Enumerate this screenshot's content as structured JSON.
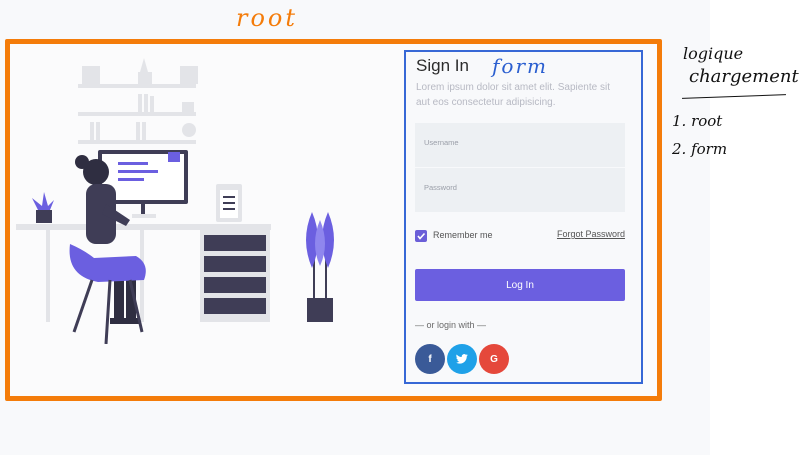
{
  "annotations": {
    "root_label": "root",
    "form_label": "form",
    "notes_title_line1": "logique",
    "notes_title_line2": "chargement",
    "notes_step1": "1. root",
    "notes_step2": "2. form"
  },
  "form": {
    "title": "Sign In",
    "subtitle": "Lorem ipsum dolor sit amet elit. Sapiente sit aut eos consectetur adipisicing.",
    "username_placeholder": "Username",
    "password_placeholder": "Password",
    "remember_label": "Remember me",
    "remember_checked": true,
    "forgot_label": "Forgot Password",
    "login_label": "Log In",
    "alt_login_text": "— or login with —",
    "social": [
      {
        "icon": "facebook-icon",
        "glyph": "f",
        "color": "#3a5a98"
      },
      {
        "icon": "twitter-icon",
        "glyph": "❧",
        "color": "#1fa1e8"
      },
      {
        "icon": "google-icon",
        "glyph": "G",
        "color": "#e5483b"
      }
    ]
  },
  "colors": {
    "root_border": "#f47c0a",
    "form_border": "#3768d6",
    "accent": "#6b5fe0"
  }
}
